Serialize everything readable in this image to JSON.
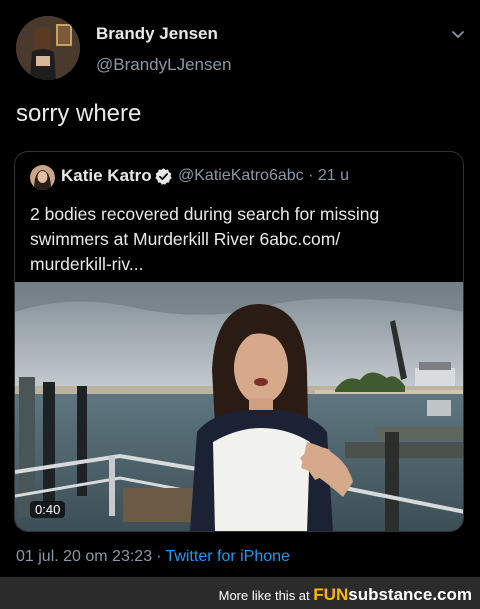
{
  "author": {
    "name": "Brandy Jensen",
    "handle": "@BrandyLJensen"
  },
  "tweet": {
    "text": "sorry where"
  },
  "quoted": {
    "name": "Katie Katro",
    "handle": "@KatieKatro6abc",
    "time": "· 21 u",
    "text_lines": [
      "2 bodies recovered during search for missing",
      "swimmers at Murderkill River 6abc.com/",
      "murderkill-riv..."
    ],
    "video_duration": "0:40"
  },
  "meta": {
    "timestamp": "01 jul. 20 om 23:23",
    "separator": "·",
    "source": "Twitter for iPhone"
  },
  "watermark": {
    "prefix": "More like this at",
    "brand_fun": "FUN",
    "brand_rest": "substance.com"
  },
  "colors": {
    "background": "#000000",
    "text": "#e7e9ea",
    "muted": "#8b98a5",
    "link": "#1d9bf0",
    "verified": "#e7e9ea",
    "footer_bg": "#2b2b2b",
    "brand_accent": "#ffb400"
  },
  "icons": [
    "avatar",
    "chevron-down-icon",
    "verified-badge-icon"
  ]
}
